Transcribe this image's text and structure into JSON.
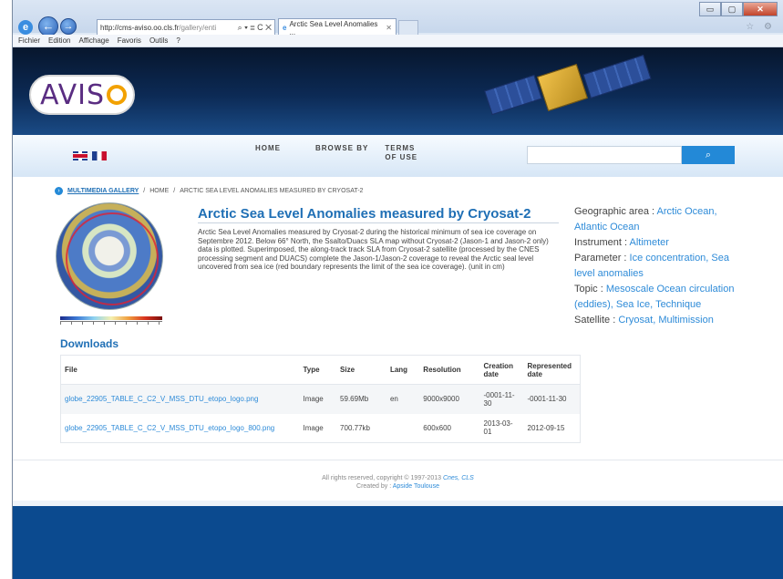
{
  "browser": {
    "url_main": "http://cms-aviso.oo.cls.fr",
    "url_rest": "/gallery/enti",
    "url_controls": "⌕ ▾ ≣ C ✕",
    "tab_title": "Arctic Sea Level Anomalies ...",
    "tab_close": "✕",
    "win_min": "▭",
    "win_max": "▢",
    "win_close": "✕",
    "fav_icons": "☆ ⚙",
    "menu": [
      "Fichier",
      "Edition",
      "Affichage",
      "Favoris",
      "Outils",
      "?"
    ]
  },
  "brand": {
    "logo_a": "AVIS",
    "logo_o": ""
  },
  "nav": {
    "home": "HOME",
    "browse": "BROWSE BY",
    "terms": "TERMS OF USE",
    "search_placeholder": "",
    "search_icon": "⌕"
  },
  "breadcrumb": {
    "root": "MULTIMEDIA GALLERY",
    "sep": "/",
    "home": "HOME",
    "current": "ARCTIC SEA LEVEL ANOMALIES MEASURED BY CRYOSAT-2"
  },
  "image": {
    "signature": "cnes/aviso"
  },
  "item": {
    "title": "Arctic Sea Level Anomalies measured by Cryosat-2",
    "description": "Arctic Sea Level Anomalies measured by Cryosat-2 during the historical minimum of sea ice coverage on Septembre 2012. Below 66° North, the Ssalto/Duacs SLA map without Cryosat-2 (Jason-1 and Jason-2 only) data is plotted. Superimposed, the along-track track SLA from Cryosat-2 satellite (processed by the CNES processing segment and DUACS) complete the Jason-1/Jason-2 coverage to reveal the Arctic seal level uncovered from sea ice (red boundary represents the limit of the sea ice coverage). (unit in cm)"
  },
  "meta": {
    "geo_label": "Geographic area :",
    "geo_value": "Arctic Ocean, Atlantic Ocean",
    "instrument_label": "Instrument :",
    "instrument_value": "Altimeter",
    "parameter_label": "Parameter :",
    "parameter_value": "Ice concentration, Sea level anomalies",
    "topic_label": "Topic :",
    "topic_value": "Mesoscale Ocean circulation (eddies), Sea Ice, Technique",
    "satellite_label": "Satellite :",
    "satellite_value": "Cryosat, Multimission"
  },
  "downloads": {
    "title": "Downloads",
    "headers": [
      "File",
      "Type",
      "Size",
      "Lang",
      "Resolution",
      "Creation date",
      "Represented date"
    ],
    "rows": [
      [
        "globe_22905_TABLE_C_C2_V_MSS_DTU_etopo_logo.png",
        "Image",
        "59.69Mb",
        "en",
        "9000x9000",
        "-0001-11-30",
        "-0001-11-30"
      ],
      [
        "globe_22905_TABLE_C_C2_V_MSS_DTU_etopo_logo_800.png",
        "Image",
        "700.77kb",
        "",
        "600x600",
        "2013-03-01",
        "2012-09-15"
      ]
    ]
  },
  "footer": {
    "copyright": "All rights reserved, copyright © 1997-2013",
    "links": "Cnes, CLS",
    "created_by": "Created by :",
    "creator": "Apside Toulouse"
  }
}
